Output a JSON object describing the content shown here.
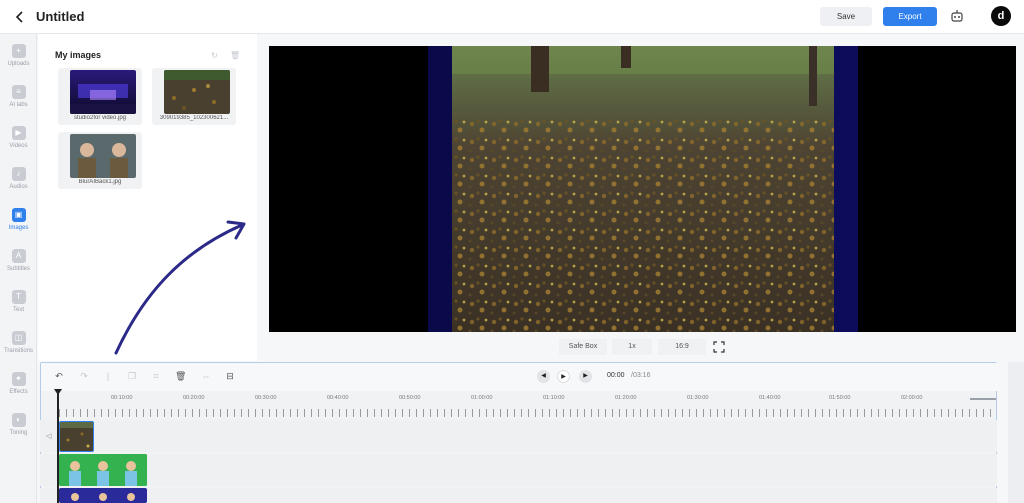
{
  "app": {
    "title": "Untitled",
    "save_label": "Save",
    "export_label": "Export",
    "avatar_letter": "d",
    "accent": "#2f80ed"
  },
  "rail": {
    "items": [
      {
        "label": "Uploads",
        "icon": "upload-icon"
      },
      {
        "label": "AI labs",
        "icon": "ai-labs-icon"
      },
      {
        "label": "Videos",
        "icon": "video-icon"
      },
      {
        "label": "Audios",
        "icon": "audio-icon"
      },
      {
        "label": "Images",
        "icon": "image-icon",
        "active": true
      },
      {
        "label": "Subtitles",
        "icon": "subtitles-icon"
      },
      {
        "label": "Text",
        "icon": "text-icon"
      },
      {
        "label": "Transitions",
        "icon": "transitions-icon"
      },
      {
        "label": "Effects",
        "icon": "effects-icon"
      },
      {
        "label": "Toning",
        "icon": "toning-icon"
      }
    ]
  },
  "panel": {
    "title": "My images",
    "images": [
      {
        "name": "studio2for video.jpg"
      },
      {
        "name": "309019385_102300621..."
      },
      {
        "name": "BlurAIBack1.jpg"
      }
    ]
  },
  "preview": {
    "safe_box": "Safe Box",
    "speed": "1x",
    "ratio": "16:9"
  },
  "timeline": {
    "current_time": "00:00",
    "total_time": "/03:16",
    "ruler_labels": [
      "00:10:00",
      "00:20:00",
      "00:30:00",
      "00:40:00",
      "00:50:00",
      "01:00:00",
      "01:10:00",
      "01:20:00",
      "01:30:00",
      "01:40:00",
      "01:50:00",
      "02:00:00"
    ]
  }
}
